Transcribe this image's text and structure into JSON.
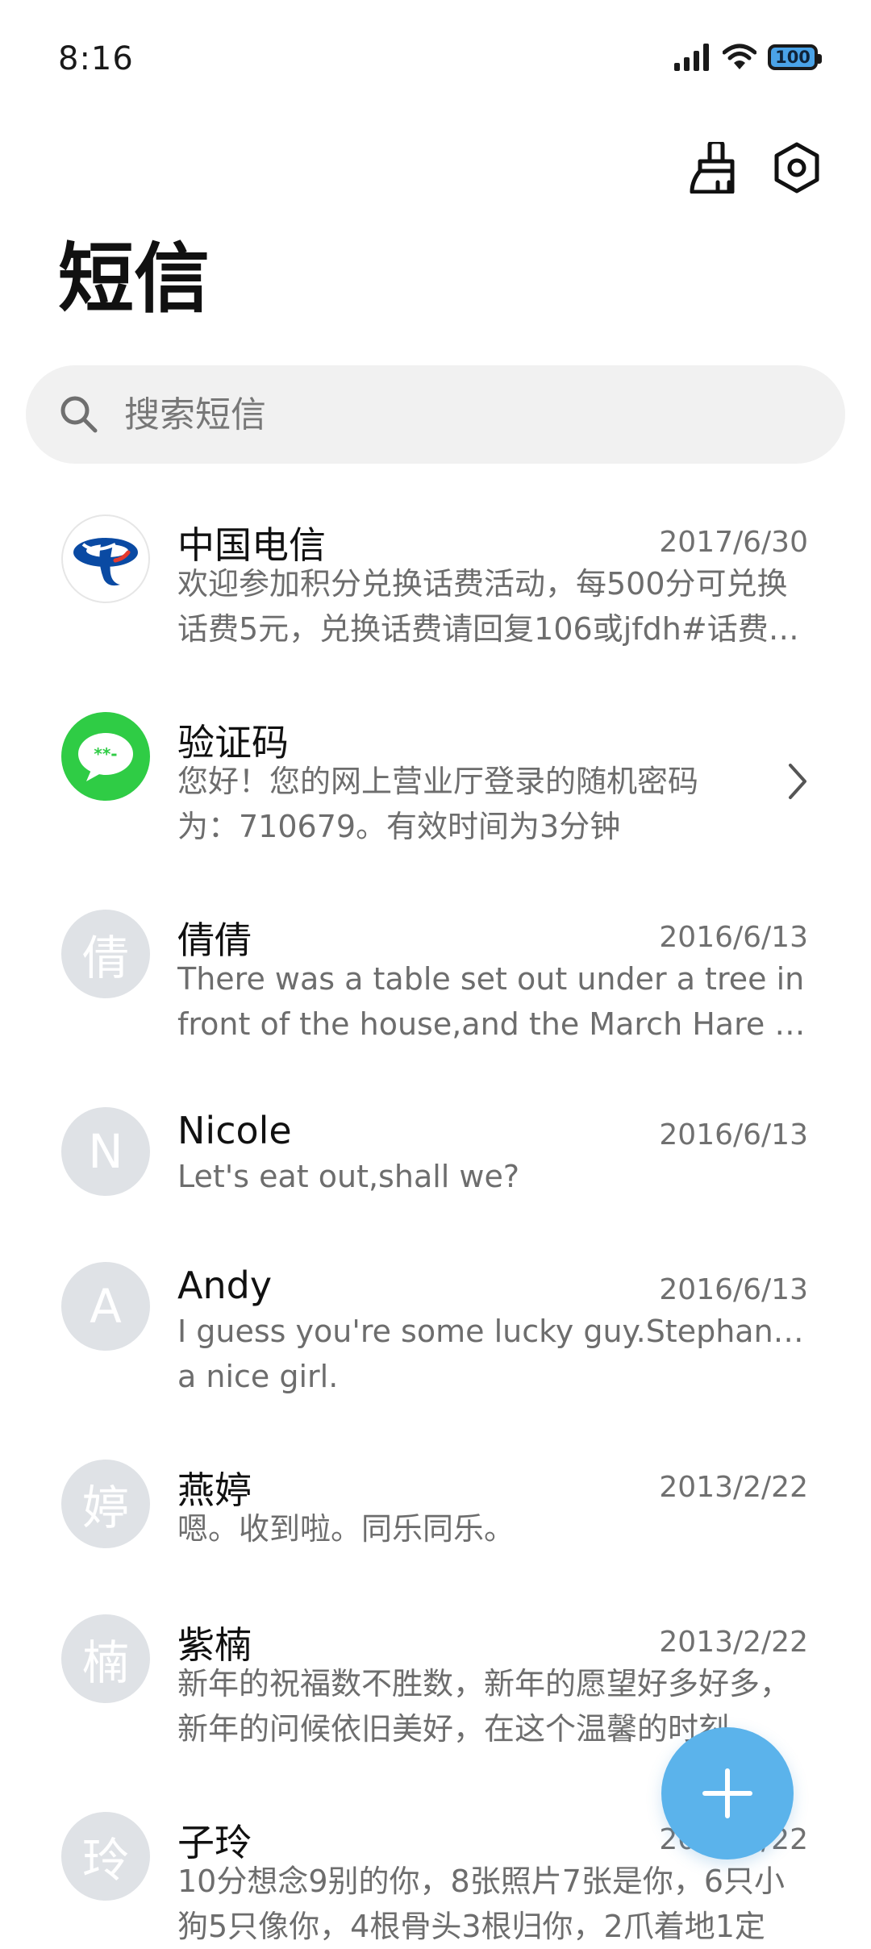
{
  "status_bar": {
    "time": "8:16",
    "battery": "100",
    "icons": [
      "signal-icon",
      "wifi-icon",
      "battery-icon"
    ]
  },
  "header": {
    "title": "短信",
    "actions": [
      "broom-icon",
      "settings-icon"
    ]
  },
  "search": {
    "placeholder": "搜索短信"
  },
  "colors": {
    "fab": "#5bb3eb",
    "avatar_placeholder": "#dfe2e6",
    "verification_green": "#2fcc45",
    "telecom_blue": "#0a4aa3"
  },
  "conversations": [
    {
      "sender": "中国电信",
      "date": "2017/6/30",
      "avatar": "telecom-logo",
      "preview_lines": [
        "欢迎参加积分兑换话费活动，每500分可兑换",
        "话费5元，兑换话费请回复106或jfdh#话费…"
      ]
    },
    {
      "sender": "验证码",
      "date": "",
      "avatar": "chat-bubble-icon",
      "preview_lines": [
        "您好！您的网上营业厅登录的随机密码",
        "为：710679。有效时间为3分钟"
      ]
    },
    {
      "sender": "倩倩",
      "date": "2016/6/13",
      "avatar": "倩",
      "preview_lines": [
        "There was a table set out under a tree in",
        "front of the house,and the March Hare an…"
      ]
    },
    {
      "sender": "Nicole",
      "date": "2016/6/13",
      "avatar": "N",
      "preview_lines": [
        "Let's eat out,shall we?"
      ]
    },
    {
      "sender": "Andy",
      "date": "2016/6/13",
      "avatar": "A",
      "preview_lines": [
        "I guess you're some lucky guy.Stephanie is",
        "a nice girl."
      ]
    },
    {
      "sender": "燕婷",
      "date": "2013/2/22",
      "avatar": "婷",
      "preview_lines": [
        "嗯。收到啦。同乐同乐。"
      ]
    },
    {
      "sender": "紫楠",
      "date": "2013/2/22",
      "avatar": "楠",
      "preview_lines": [
        "新年的祝福数不胜数，新年的愿望好多好多，",
        "新年的问候依旧美好，在这个温馨的时刻…"
      ]
    },
    {
      "sender": "子玲",
      "date": "2013/2/22",
      "avatar": "玲",
      "preview_lines": [
        "10分想念9别的你，8张照片7张是你，6只小",
        "狗5只像你，4根骨头3根归你，2爪着地1定"
      ]
    }
  ],
  "fab": {
    "icon": "plus-icon"
  }
}
